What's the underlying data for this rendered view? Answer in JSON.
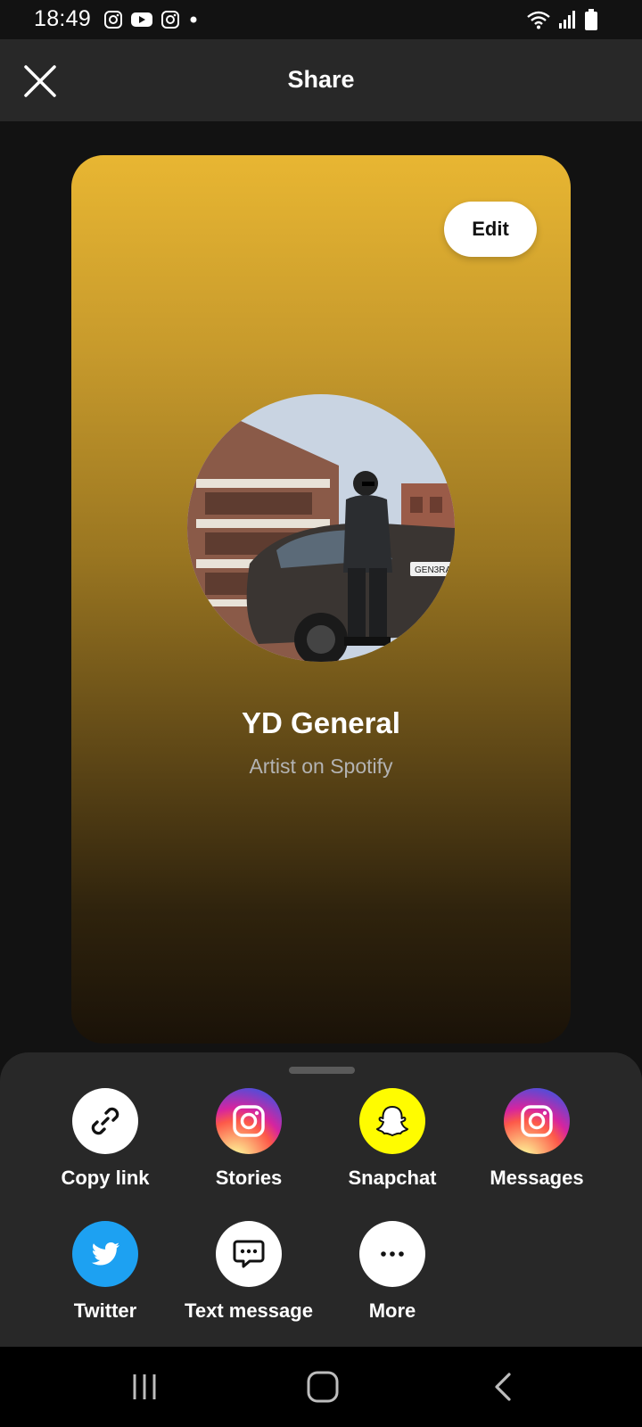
{
  "status_bar": {
    "time": "18:49",
    "left_icons": [
      "instagram-icon",
      "youtube-icon",
      "instagram-icon",
      "notification-dot-icon"
    ],
    "right_icons": [
      "wifi-icon",
      "signal-icon",
      "battery-icon"
    ]
  },
  "header": {
    "title": "Share",
    "close_icon": "close-icon"
  },
  "card": {
    "edit_label": "Edit",
    "artist_name": "YD General",
    "subtitle": "Artist on Spotify",
    "gradient_colors": [
      "#e8b632",
      "#1a1208"
    ]
  },
  "share_options": [
    {
      "label": "Copy link",
      "icon": "link-icon"
    },
    {
      "label": "Stories",
      "icon": "instagram-icon"
    },
    {
      "label": "Snapchat",
      "icon": "snapchat-icon"
    },
    {
      "label": "Messages",
      "icon": "instagram-icon"
    },
    {
      "label": "Twitter",
      "icon": "twitter-icon"
    },
    {
      "label": "Text message",
      "icon": "message-icon"
    },
    {
      "label": "More",
      "icon": "more-icon"
    }
  ],
  "nav_bar": {
    "buttons": [
      "recent-apps-icon",
      "home-icon",
      "back-icon"
    ]
  },
  "colors": {
    "background": "#121212",
    "sheet": "#282828",
    "snapchat": "#FFFC00",
    "twitter": "#1DA1F2",
    "card_top": "#e8b632"
  }
}
